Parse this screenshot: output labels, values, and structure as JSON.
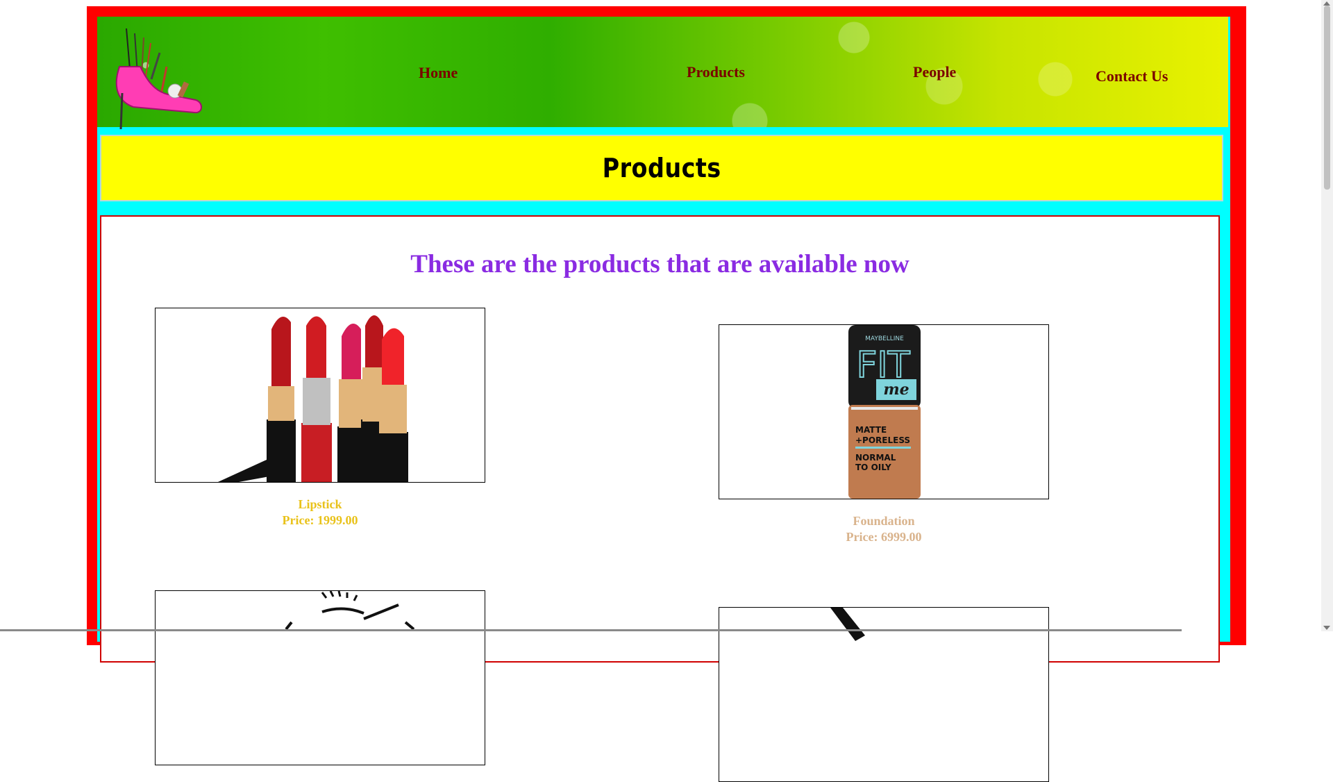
{
  "nav": {
    "home": "Home",
    "products": "Products",
    "people": "People",
    "contact": "Contact Us"
  },
  "banner": {
    "title": "Products"
  },
  "content": {
    "intro": "These are the products that are available now",
    "products": [
      {
        "name": "Lipstick",
        "price": "Price: 1999.00",
        "color": "#e9c21a",
        "image": "lipsticks-image"
      },
      {
        "name": "Foundation",
        "price": "Price: 6999.00",
        "color": "#d9b38c",
        "image": "foundation-bottle-image"
      },
      {
        "name": "",
        "price": "",
        "image": "eyelashes-image"
      },
      {
        "name": "",
        "price": "",
        "image": "brush-image"
      }
    ]
  },
  "colors": {
    "outer_border": "#ff0000",
    "frame": "#00ffff",
    "banner": "#ffff00",
    "nav_text": "#7a0000",
    "intro_text": "#8a2be2"
  }
}
